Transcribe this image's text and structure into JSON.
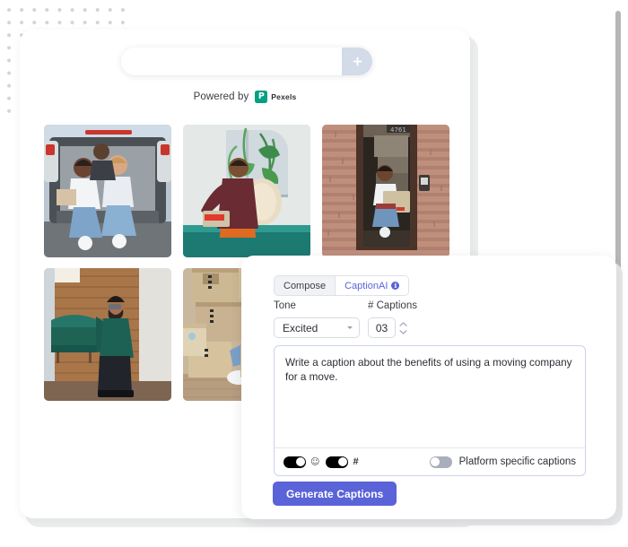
{
  "decor": {
    "dot_grid_color": "#d3d3d6"
  },
  "gallery": {
    "search": {
      "value": "",
      "placeholder": "",
      "add_button_icon": "plus-icon",
      "add_button_color": "#d3dae8"
    },
    "attribution": {
      "prefix": "Powered by",
      "provider": "Pexels",
      "provider_mark": "P",
      "provider_color": "#05a081"
    },
    "photos": [
      {
        "id": "photo-1",
        "alt": "Two women sitting in the open back of a moving van with boxes",
        "scene": "van"
      },
      {
        "id": "photo-2",
        "alt": "Smiling man in maroon shirt holding a large woven planter with palm leaves",
        "scene": "plant"
      },
      {
        "id": "photo-3",
        "alt": "Woman carrying a cardboard box through a brick doorway",
        "scene": "doorway"
      },
      {
        "id": "photo-4",
        "alt": "Mover in mask carrying a green velvet sofa along a wood wall",
        "scene": "sofa"
      },
      {
        "id": "photo-5",
        "alt": "Woman taping cardboard boxes with red tape on the floor",
        "scene": "boxes"
      }
    ]
  },
  "caption_panel": {
    "tabs": [
      {
        "label": "Compose",
        "active": false
      },
      {
        "label": "CaptionAI",
        "active": true,
        "info_icon": "info-icon"
      }
    ],
    "fields": {
      "tone_label": "Tone",
      "tone_value": "Excited",
      "tone_options": [
        "Excited"
      ],
      "captions_label": "# Captions",
      "captions_value": "03"
    },
    "prompt": {
      "value": "Write a caption about the benefits of using a moving company for a move.",
      "placeholder": ""
    },
    "toolbar": {
      "emoji_toggle": {
        "icon": "emoji-icon",
        "state": "on"
      },
      "hashtag_toggle": {
        "icon": "hashtag-icon",
        "state": "on"
      },
      "platform_toggle": {
        "label": "Platform specific captions",
        "state": "off"
      }
    },
    "generate_button": {
      "label": "Generate Captions",
      "color": "#5a63d8"
    }
  }
}
